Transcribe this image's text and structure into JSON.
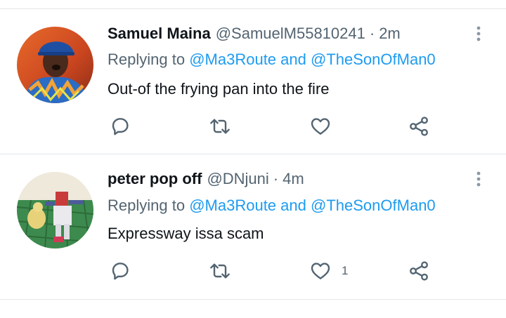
{
  "colors": {
    "text": "#0f1419",
    "muted": "#536471",
    "mention": "#1d9bf0",
    "divider": "#e3e6e8"
  },
  "tweets": [
    {
      "name": "Samuel Maina",
      "handle": "@SamuelM55810241",
      "separator": "·",
      "time": "2m",
      "replying_prefix": "Replying to",
      "mention_1": "@Ma3Route",
      "conjunction": "and",
      "mention_2": "@TheSonOfMan0",
      "text": "Out-of the frying pan into the fire",
      "like_count": "",
      "icons": [
        "reply-icon",
        "retweet-icon",
        "like-icon",
        "share-icon",
        "more-icon"
      ]
    },
    {
      "name": "peter pop off",
      "handle": "@DNjuni",
      "separator": "·",
      "time": "4m",
      "replying_prefix": "Replying to",
      "mention_1": "@Ma3Route",
      "conjunction": "and",
      "mention_2": "@TheSonOfMan0",
      "text": "Expressway issa scam",
      "like_count": "1",
      "icons": [
        "reply-icon",
        "retweet-icon",
        "like-icon",
        "share-icon",
        "more-icon"
      ]
    }
  ]
}
